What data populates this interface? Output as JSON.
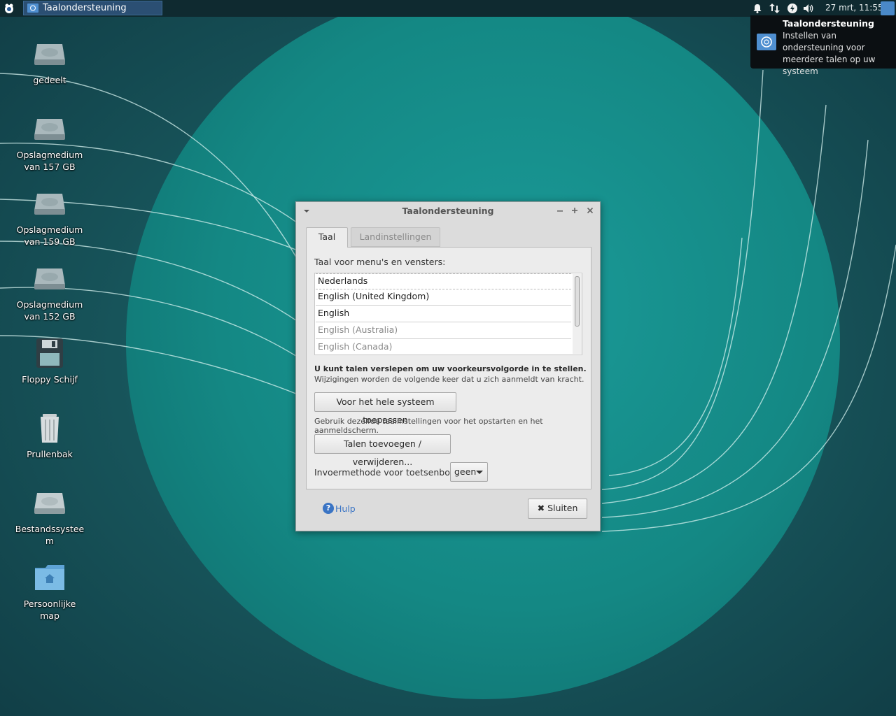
{
  "panel": {
    "taskbar_title": "Taalondersteuning",
    "clock": "27 mrt, 11:55",
    "tray_icons": [
      "bell-icon",
      "network-transfer-icon",
      "power-icon",
      "volume-icon"
    ]
  },
  "notification": {
    "title": "Taalondersteuning",
    "body": "Instellen van ondersteuning voor meerdere talen op uw systeem"
  },
  "desktop": {
    "icons": [
      {
        "label": "gedeelt",
        "icon": "drive-icon"
      },
      {
        "label": "Opslagmedium van 157 GB",
        "icon": "drive-icon"
      },
      {
        "label": "Opslagmedium van 159 GB",
        "icon": "drive-icon"
      },
      {
        "label": "Opslagmedium van 152 GB",
        "icon": "drive-icon"
      },
      {
        "label": "Floppy Schijf",
        "icon": "floppy-icon"
      },
      {
        "label": "Prullenbak",
        "icon": "trash-icon"
      },
      {
        "label": "Bestandssysteem",
        "icon": "drive-icon"
      },
      {
        "label": "Persoonlijke map",
        "icon": "home-folder-icon"
      }
    ]
  },
  "dialog": {
    "title": "Taalondersteuning",
    "tabs": [
      {
        "label": "Taal",
        "active": true
      },
      {
        "label": "Landinstellingen",
        "active": false
      }
    ],
    "list_label": "Taal voor menu's en vensters:",
    "languages": [
      {
        "label": "Nederlands",
        "dim": false
      },
      {
        "label": "English (United Kingdom)",
        "dim": false
      },
      {
        "label": "English",
        "dim": false
      },
      {
        "label": "English (Australia)",
        "dim": true
      },
      {
        "label": "English (Canada)",
        "dim": true
      }
    ],
    "hint_bold": "U kunt talen verslepen om uw voorkeursvolgorde in te stellen.",
    "hint_normal": "Wijzigingen worden de volgende keer dat u zich aanmeldt van kracht.",
    "apply_button": "Voor het hele systeem toepassen",
    "apply_info": "Gebruik dezelfde taalinstellingen voor het opstarten en het aanmeldscherm.",
    "add_button": "Talen toevoegen / verwijderen...",
    "input_method_label": "Invoermethode voor toetsenbord:",
    "input_method_value": "geen",
    "help_label": "Hulp",
    "close_label": "Sluiten"
  },
  "colors": {
    "desktop_bg": "#1b5a60",
    "circle": "#17898a",
    "panel": "#0f2a30",
    "link": "#3a74c4"
  }
}
